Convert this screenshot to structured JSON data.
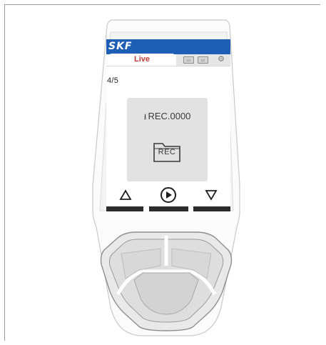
{
  "device": {
    "brand": "SKF",
    "colors": {
      "brand_bar": "#1c5fb5",
      "live_tab": "#c23b3b",
      "card": "#e2e2e2"
    }
  },
  "screen": {
    "tab_active_label": "Live",
    "toolbar_icons": [
      "memory-card-icon",
      "memory-card-icon",
      "gear-icon"
    ],
    "counter": "4/5",
    "recording": {
      "name": "REC.0000",
      "folder_label": "REC",
      "icon": "download-icon"
    },
    "nav": [
      "triangle-up-icon",
      "play-circle-icon",
      "triangle-down-icon"
    ]
  }
}
